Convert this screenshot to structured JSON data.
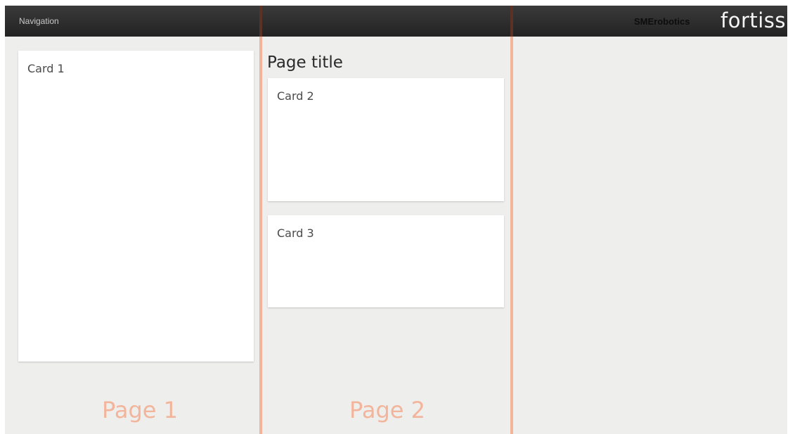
{
  "header": {
    "nav_label": "Navigation",
    "brand_text": "SMErobotics",
    "logo_text": "fortiss"
  },
  "main": {
    "page_title": "Page title",
    "cards": [
      {
        "label": "Card 1"
      },
      {
        "label": "Card 2"
      },
      {
        "label": "Card 3"
      }
    ],
    "page_labels": [
      "Page 1",
      "Page 2"
    ]
  },
  "colors": {
    "topbar": "#2d2d2d",
    "background": "#eeeeec",
    "card": "#ffffff",
    "accent": "#f2b59c"
  }
}
